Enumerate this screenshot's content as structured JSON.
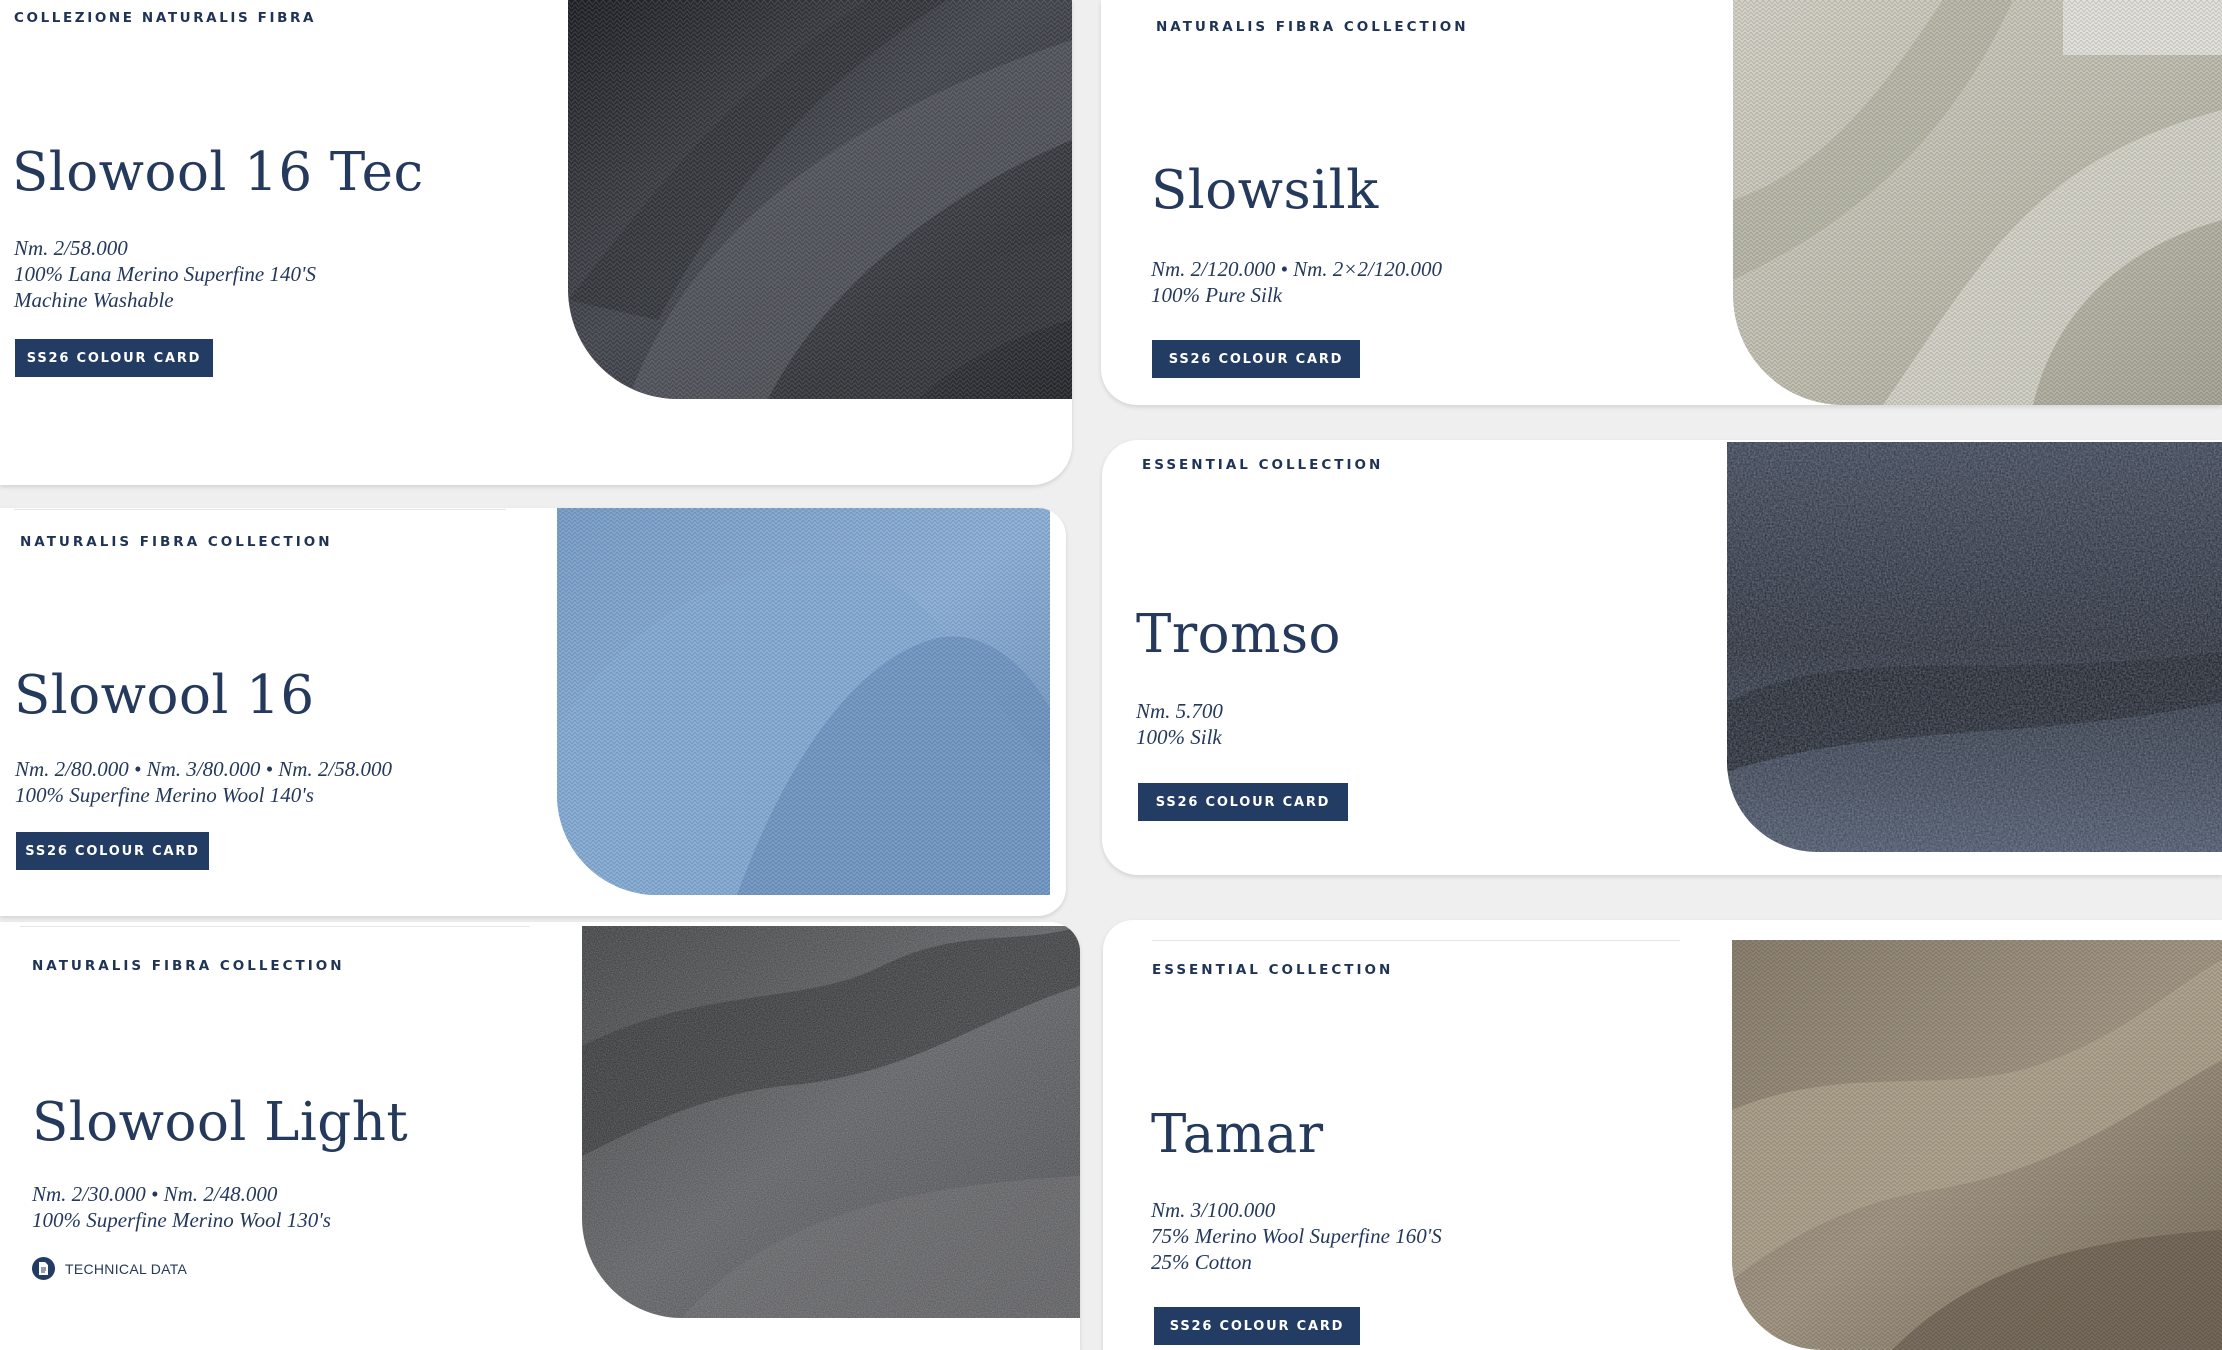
{
  "cards": {
    "c1": {
      "eyebrow": "COLLEZIONE NATURALIS FIBRA",
      "title": "Slowool 16 Tec",
      "specs": [
        "Nm. 2/58.000",
        "100% Lana Merino Superfine 140'S",
        "Machine Washable"
      ],
      "cta": "SS26 COLOUR CARD",
      "swatch": "charcoal-wool-knit"
    },
    "c2": {
      "eyebrow": "NATURALIS FIBRA COLLECTION",
      "title": "Slowsilk",
      "specs": [
        "Nm. 2/120.000 • Nm. 2×2/120.000",
        "100% Pure Silk"
      ],
      "cta": "SS26 COLOUR CARD",
      "swatch": "ivory-silk-knit"
    },
    "c3": {
      "eyebrow": "NATURALIS FIBRA COLLECTION",
      "title": "Slowool 16",
      "specs": [
        "Nm. 2/80.000 • Nm. 3/80.000 • Nm. 2/58.000",
        "100% Superfine Merino Wool 140's"
      ],
      "cta": "SS26 COLOUR CARD",
      "swatch": "light-blue-wool-knit"
    },
    "c4": {
      "eyebrow": "ESSENTIAL COLLECTION",
      "title": "Tromso",
      "specs": [
        "Nm. 5.700",
        "100% Silk"
      ],
      "cta": "SS26 COLOUR CARD",
      "swatch": "navy-boucle-knit"
    },
    "c5": {
      "eyebrow": "NATURALIS FIBRA COLLECTION",
      "title": "Slowool Light",
      "specs": [
        "Nm. 2/30.000 • Nm. 2/48.000",
        "100% Superfine Merino Wool 130's"
      ],
      "tech_label": "TECHNICAL DATA",
      "swatch": "grey-fuzzy-wool"
    },
    "c6": {
      "eyebrow": "ESSENTIAL COLLECTION",
      "title": "Tamar",
      "specs": [
        "Nm. 3/100.000",
        "75% Merino Wool Superfine 160'S",
        "25% Cotton"
      ],
      "cta": "SS26 COLOUR CARD",
      "swatch": "taupe-cotton-knit"
    }
  },
  "colors": {
    "navy": "#233c63",
    "text": "#24395c",
    "card_bg": "#ffffff",
    "page_bg": "#efefef"
  }
}
